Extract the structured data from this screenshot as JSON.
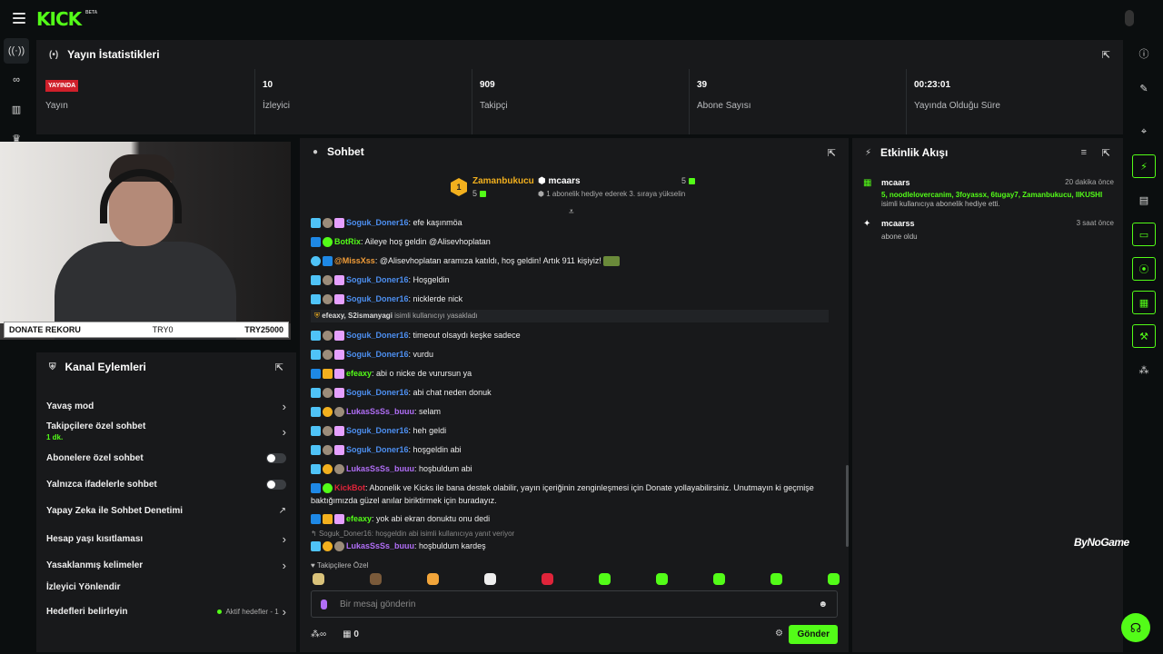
{
  "app": {
    "logo": "KICK",
    "logo_tag": "BETA"
  },
  "colors": {
    "accent": "#53fc18",
    "live": "#d0202b",
    "panel": "#18191b"
  },
  "left_rail": {
    "icons": [
      "broadcast-icon",
      "link-icon",
      "chart-icon",
      "trophy-icon"
    ]
  },
  "right_rail": {
    "icons": [
      "info-icon",
      "pen-icon",
      "focus-icon",
      "lightning-icon",
      "document-icon",
      "chat-icon",
      "broadcast-icon",
      "layout-icon",
      "wrench-icon",
      "community-icon"
    ]
  },
  "stats": {
    "title": "Yayın İstatistikleri",
    "cells": [
      {
        "value": "YAYINDA",
        "label": "Yayın"
      },
      {
        "value": "10",
        "label": "İzleyici"
      },
      {
        "value": "909",
        "label": "Takipçi"
      },
      {
        "value": "39",
        "label": "Abone Sayısı"
      },
      {
        "value": "00:23:01",
        "label": "Yayında Olduğu Süre"
      }
    ]
  },
  "donate": {
    "label": "DONATE REKORU",
    "current": "TRY0",
    "record": "TRY25000"
  },
  "kanal": {
    "title": "Kanal Eylemleri",
    "rows": [
      {
        "label": "Yavaş mod",
        "control": "chevron"
      },
      {
        "label": "Takipçilere özel sohbet",
        "sub": "1 dk.",
        "control": "chevron"
      },
      {
        "label": "Abonelere özel sohbet",
        "control": "toggle"
      },
      {
        "label": "Yalnızca ifadelerle sohbet",
        "control": "toggle"
      },
      {
        "label": "Yapay Zeka ile Sohbet Denetimi",
        "control": "external"
      },
      {
        "label": "Hesap yaşı kısıtlaması",
        "control": "chevron"
      },
      {
        "label": "Yasaklanmış kelimeler",
        "control": "chevron"
      },
      {
        "label": "İzleyici Yönlendir",
        "control": "none"
      },
      {
        "label": "Hedefleri belirleyin",
        "aktif": "Aktif hedefler - 1",
        "control": "chevron"
      }
    ]
  },
  "chat": {
    "title": "Sohbet",
    "pinned": {
      "top_name": "Zamanbukucu",
      "top_rank": "1",
      "top_count": "5",
      "second_name": "mcaars",
      "second_count": "5",
      "second_desc": "1 abonelik hediye ederek 3. sıraya yükselin"
    },
    "messages": [
      {
        "user": "Soguk_Doner16",
        "color": "blue",
        "text": "efe kaşınmöa"
      },
      {
        "user": "BotRix",
        "color": "green",
        "text": "Aileye hoş geldin @Alisevhoplatan"
      },
      {
        "user": "@MissXss",
        "color": "orange",
        "text": "@Alisevhoplatan aramıza katıldı, hoş geldin! Artık 911 kişiyiz!"
      },
      {
        "user": "Soguk_Doner16",
        "color": "blue",
        "text": "Hoşgeldin"
      },
      {
        "user": "Soguk_Doner16",
        "color": "blue",
        "text": "nicklerde nick"
      },
      {
        "user": "efeaxy, S2ismanyagi",
        "color": "system",
        "text": "isimli kullanıcıyı yasakladı"
      },
      {
        "user": "Soguk_Doner16",
        "color": "blue",
        "text": "timeout olsaydı keşke sadece"
      },
      {
        "user": "Soguk_Doner16",
        "color": "blue",
        "text": "vurdu"
      },
      {
        "user": "efeaxy",
        "color": "green",
        "text": "abi o nicke de vurursun ya"
      },
      {
        "user": "Soguk_Doner16",
        "color": "blue",
        "text": "abi chat neden donuk"
      },
      {
        "user": "LukasSsSs_buuu",
        "color": "purple",
        "text": "selam"
      },
      {
        "user": "Soguk_Doner16",
        "color": "blue",
        "text": "heh geldi"
      },
      {
        "user": "Soguk_Doner16",
        "color": "blue",
        "text": "hoşgeldin abi"
      },
      {
        "user": "LukasSsSs_buuu",
        "color": "purple",
        "text": "hoşbuldum abi"
      },
      {
        "user": "KickBot",
        "color": "red",
        "text": "Abonelik ve Kicks ile bana destek olabilir, yayın içeriğinin zenginleşmesi için Donate yollayabilirsiniz. Unutmayın ki geçmişe baktığımızda güzel anılar biriktirmek için buradayız."
      },
      {
        "user": "efeaxy",
        "color": "green",
        "text": "yok abi ekran donuktu onu dedi"
      },
      {
        "user": "Soguk_Doner16:",
        "color": "reply",
        "text": "hoşgeldin abi isimli kullanıcıya yanıt veriyor"
      },
      {
        "user": "LukasSsSs_buuu",
        "color": "purple",
        "text": "hoşbuldum kardeş"
      }
    ],
    "emotes_label": "Takipçilere Özel",
    "input_placeholder": "Bir mesaj gönderin",
    "kicks_count": "0",
    "send_label": "Gönder"
  },
  "activity": {
    "title": "Etkinlik Akışı",
    "items": [
      {
        "name": "mcaars",
        "time": "20 dakika önce",
        "line1": "5, noodlelovercanim, 3foyassx, 6tugay7, Zamanbukucu, IIKUSHI",
        "line2": "isimli kullanıcıya abonelik hediye etti.",
        "icon": "gift-icon"
      },
      {
        "name": "mcaarss",
        "time": "3 saat önce",
        "line1": "",
        "line2": "abone oldu",
        "icon": "sparkle-icon"
      }
    ]
  },
  "watermark": "ByNoGame"
}
